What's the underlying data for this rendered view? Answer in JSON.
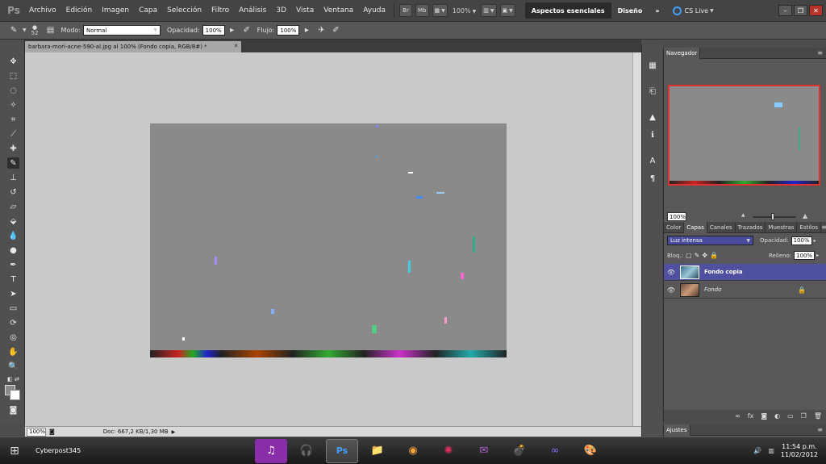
{
  "menubar": {
    "logo": "Ps",
    "items": [
      "Archivo",
      "Edición",
      "Imagen",
      "Capa",
      "Selección",
      "Filtro",
      "Análisis",
      "3D",
      "Vista",
      "Ventana",
      "Ayuda"
    ],
    "bridge_label": "Br",
    "minibridge_label": "Mb",
    "zoom": "100%",
    "workspace_active": "Aspectos esenciales",
    "workspace_other": "Diseño",
    "more": "»",
    "cs_live": "CS Live"
  },
  "options": {
    "brush_size": "52",
    "mode_label": "Modo:",
    "mode_value": "Normal",
    "opacity_label": "Opacidad:",
    "opacity_value": "100%",
    "flow_label": "Flujo:",
    "flow_value": "100%"
  },
  "document": {
    "tab_title": "barbara-mori-acne-590-al.jpg al 100% (Fondo copia, RGB/8#) *",
    "zoom": "100%",
    "doc_info": "Doc: 667,2 KB/1,30 MB"
  },
  "navigator": {
    "title": "Navegador",
    "zoom": "100%"
  },
  "layers": {
    "tabs": [
      "Color",
      "Capas",
      "Canales",
      "Trazados",
      "Muestras",
      "Estilos"
    ],
    "active_tab": "Capas",
    "blend_mode": "Luz intensa",
    "opacity_label": "Opacidad:",
    "opacity_value": "100%",
    "lock_label": "Bloq.:",
    "fill_label": "Relleno:",
    "fill_value": "100%",
    "items": [
      {
        "name": "Fondo copia",
        "selected": true
      },
      {
        "name": "Fondo",
        "selected": false
      }
    ]
  },
  "adjust": {
    "title": "Ajustes"
  },
  "taskbar": {
    "user": "Cyberpost345",
    "time": "11:54 p.m.",
    "date": "11/02/2012"
  },
  "colors": {
    "accent": "#5050a0",
    "canvas_bg": "#c9c9c9",
    "nav_frame": "#e03030"
  }
}
